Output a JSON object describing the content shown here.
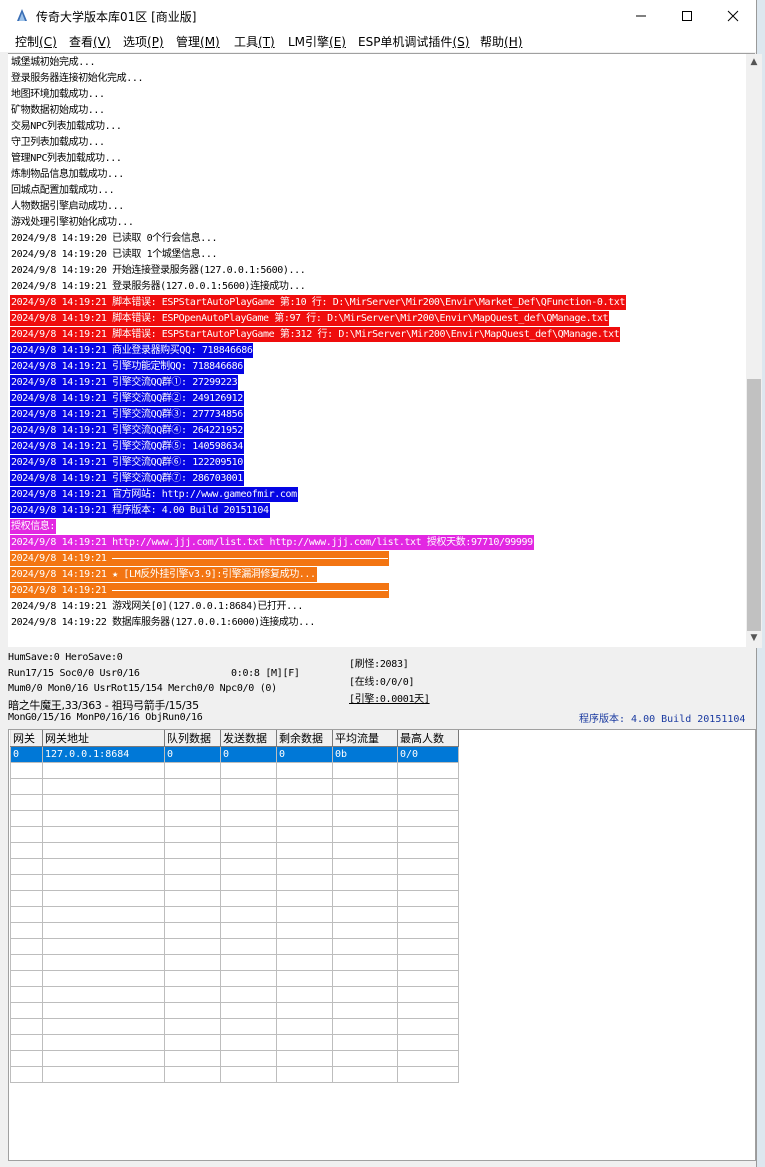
{
  "window": {
    "title": "传奇大学版本库01区 [商业版]"
  },
  "menu": [
    {
      "label": "控制",
      "key": "(C)"
    },
    {
      "label": "查看",
      "key": "(V)"
    },
    {
      "label": "选项",
      "key": "(P)"
    },
    {
      "label": "管理",
      "key": "(M)"
    },
    {
      "label": "工具",
      "key": "(T)"
    },
    {
      "label": "LM引擎",
      "key": "(E)"
    },
    {
      "label": "ESP单机调试插件",
      "key": "(S)"
    },
    {
      "label": "帮助",
      "key": "(H)"
    }
  ],
  "log": {
    "lines": [
      {
        "text": "城堡城初始完成...",
        "style": "plain"
      },
      {
        "text": "登录服务器连接初始化完成...",
        "style": "plain"
      },
      {
        "text": "地图环境加载成功...",
        "style": "plain"
      },
      {
        "text": "矿物数据初始成功...",
        "style": "plain"
      },
      {
        "text": "交易NPC列表加载成功...",
        "style": "plain"
      },
      {
        "text": "守卫列表加载成功...",
        "style": "plain"
      },
      {
        "text": "管理NPC列表加载成功...",
        "style": "plain"
      },
      {
        "text": "炼制物品信息加载成功...",
        "style": "plain"
      },
      {
        "text": "回城点配置加载成功...",
        "style": "plain"
      },
      {
        "text": "人物数据引擎启动成功...",
        "style": "plain"
      },
      {
        "text": "游戏处理引擎初始化成功...",
        "style": "plain"
      },
      {
        "text": "2024/9/8 14:19:20 已读取 0个行会信息...",
        "style": "plain"
      },
      {
        "text": "2024/9/8 14:19:20 已读取 1个城堡信息...",
        "style": "plain"
      },
      {
        "text": "2024/9/8 14:19:20 开始连接登录服务器(127.0.0.1:5600)...",
        "style": "plain"
      },
      {
        "text": "2024/9/8 14:19:21 登录服务器(127.0.0.1:5600)连接成功...",
        "style": "plain"
      },
      {
        "text": "2024/9/8 14:19:21 脚本错误: ESPStartAutoPlayGame 第:10 行: D:\\MirServer\\Mir200\\Envir\\Market_Def\\QFunction-0.txt",
        "style": "red"
      },
      {
        "text": "2024/9/8 14:19:21 脚本错误: ESPOpenAutoPlayGame 第:97 行: D:\\MirServer\\Mir200\\Envir\\MapQuest_def\\QManage.txt",
        "style": "red"
      },
      {
        "text": "2024/9/8 14:19:21 脚本错误: ESPStartAutoPlayGame 第:312 行: D:\\MirServer\\Mir200\\Envir\\MapQuest_def\\QManage.txt",
        "style": "red"
      },
      {
        "text": "2024/9/8 14:19:21 商业登录器购买QQ: 718846686",
        "style": "blue"
      },
      {
        "text": "2024/9/8 14:19:21 引擎功能定制QQ: 718846686",
        "style": "blue"
      },
      {
        "text": "2024/9/8 14:19:21 引擎交流QQ群①: 27299223",
        "style": "blue"
      },
      {
        "text": "2024/9/8 14:19:21 引擎交流QQ群②: 249126912",
        "style": "blue"
      },
      {
        "text": "2024/9/8 14:19:21 引擎交流QQ群③: 277734856",
        "style": "blue"
      },
      {
        "text": "2024/9/8 14:19:21 引擎交流QQ群④: 264221952",
        "style": "blue"
      },
      {
        "text": "2024/9/8 14:19:21 引擎交流QQ群⑤: 140598634",
        "style": "blue"
      },
      {
        "text": "2024/9/8 14:19:21 引擎交流QQ群⑥: 122209510",
        "style": "blue"
      },
      {
        "text": "2024/9/8 14:19:21 引擎交流QQ群⑦: 286703001",
        "style": "blue"
      },
      {
        "text": "2024/9/8 14:19:21 官方网站: http://www.gameofmir.com",
        "style": "blue"
      },
      {
        "text": "2024/9/8 14:19:21 程序版本: 4.00 Build 20151104",
        "style": "blue"
      },
      {
        "text": "授权信息:",
        "style": "magenta"
      },
      {
        "text": "2024/9/8 14:19:21 http://www.jjj.com/list.txt http://www.jjj.com/list.txt 授权天数:97710/99999",
        "style": "magenta"
      },
      {
        "text": "2024/9/8 14:19:21 ",
        "style": "orange-sep"
      },
      {
        "text": "2024/9/8 14:19:21 ★ [LM反外挂引擎v3.9]:引擎漏洞修复成功...",
        "style": "orange"
      },
      {
        "text": "2024/9/8 14:19:21 ",
        "style": "orange-sep"
      },
      {
        "text": "2024/9/8 14:19:21 游戏网关[0](127.0.0.1:8684)已打开...",
        "style": "plain"
      },
      {
        "text": "2024/9/8 14:19:22 数据库服务器(127.0.0.1:6000)连接成功...",
        "style": "plain"
      }
    ]
  },
  "status": {
    "line1": "HumSave:0 HeroSave:0",
    "line2a": "Run17/15 Soc0/0 Usr0/16",
    "line2b": "0:0:8 [M][F]",
    "line3": "Mum0/0 Mon0/16 UsrRot15/154 Merch0/0 Npc0/0 (0)",
    "line4": "暗之牛魔王,33/363 - 祖玛弓箭手/15/35",
    "line5": "MonG0/15/16 MonP0/16/16 ObjRun0/16",
    "refresh_monsters": "[刷怪:2083]",
    "online": "[在线:0/0/0]",
    "engine": "[引擎:0.0001天]",
    "version": "程序版本: 4.00 Build 20151104"
  },
  "gateway_table": {
    "headers": [
      "网关",
      "网关地址",
      "队列数据",
      "发送数据",
      "剩余数据",
      "平均流量",
      "最高人数"
    ],
    "rows": [
      [
        "0",
        "127.0.0.1:8684",
        "0",
        "0",
        "0",
        "0b",
        "0/0"
      ]
    ],
    "empty_rows": 20
  }
}
